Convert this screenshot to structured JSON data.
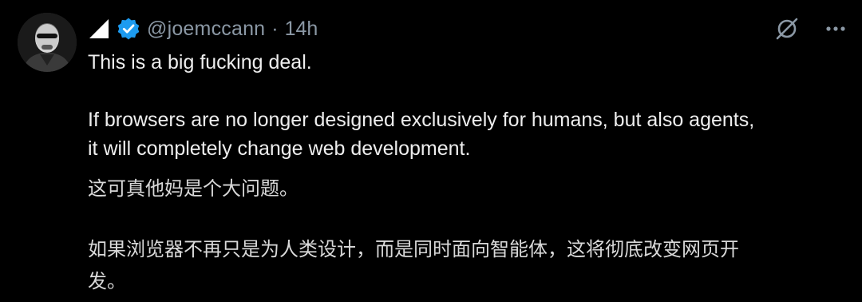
{
  "tweet": {
    "handle": "@joemccann",
    "separator": "·",
    "time": "14h",
    "icons": {
      "logo": "triangle-logo-icon",
      "verified": "verified-badge-icon",
      "grok": "grok-icon",
      "more": "more-options-icon"
    },
    "colors": {
      "verified": "#1d9bf0",
      "muted": "#8b98a5",
      "background": "#000000"
    },
    "text": {
      "line1": "This is a big fucking deal.",
      "line2": "If browsers are no longer designed exclusively for humans, but also agents,",
      "line3": "it will completely change web development."
    },
    "translation": {
      "line1": "这可真他妈是个大问题。",
      "line2": "如果浏览器不再只是为人类设计，而是同时面向智能体，这将彻底改变网页开",
      "line3": "发。"
    }
  }
}
